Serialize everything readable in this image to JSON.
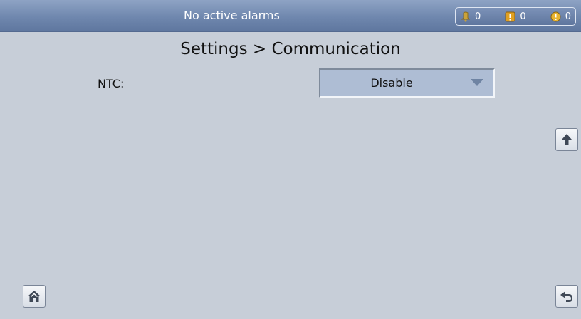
{
  "header": {
    "alarm_status": "No active alarms",
    "counters": [
      {
        "icon": "bell-icon",
        "value": "0",
        "color": "#c9a23a"
      },
      {
        "icon": "alert-square-icon",
        "value": "0",
        "color": "#e0a022"
      },
      {
        "icon": "alert-circle-icon",
        "value": "0",
        "color": "#e8b430"
      }
    ]
  },
  "page": {
    "title": "Settings > Communication"
  },
  "settings": {
    "ntc": {
      "label": "NTC:",
      "value": "Disable"
    }
  },
  "nav": {
    "up_icon": "arrow-up-icon",
    "home_icon": "home-icon",
    "back_icon": "back-arrow-icon"
  }
}
